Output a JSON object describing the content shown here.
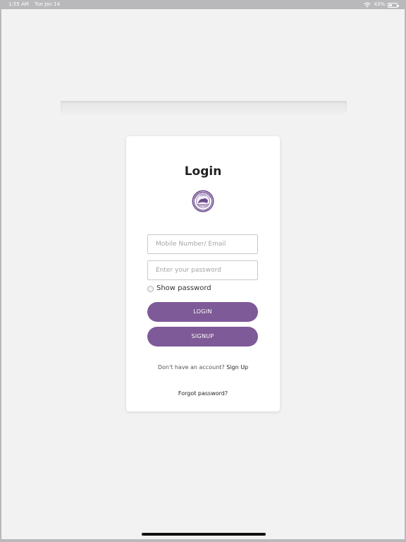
{
  "status_bar": {
    "time": "1:55 AM",
    "date": "Tue Jan 14",
    "battery": "43%",
    "battery_level": 0.43,
    "icons": [
      "wifi-icon",
      "battery-icon"
    ]
  },
  "login_card": {
    "title": "Login",
    "logo_icon": "school-crest-logo",
    "email_placeholder": "Mobile Number/ Email",
    "email_value": "",
    "password_placeholder": "Enter your password",
    "password_value": "",
    "show_password_label": "Show password",
    "show_password_checked": false,
    "login_label": "LOGIN",
    "signup_label": "SIGNUP",
    "no_account_text": "Don't have an account?",
    "sign_up_link": "Sign Up",
    "forgot_password": "Forgot password?"
  },
  "colors": {
    "accent": "#7e5a98",
    "background": "#f2f2f2",
    "card": "#ffffff",
    "status_bar": "#b9b9bb"
  }
}
